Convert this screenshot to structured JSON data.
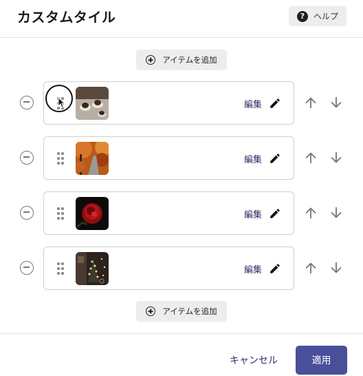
{
  "header": {
    "title": "カスタムタイル",
    "help_label": "ヘルプ"
  },
  "add_item_label": "アイテムを追加",
  "items": [
    {
      "edit_label": "編集",
      "thumbnail": "chocolate-dessert-photo"
    },
    {
      "edit_label": "編集",
      "thumbnail": "autumn-path-photo"
    },
    {
      "edit_label": "編集",
      "thumbnail": "red-rose-photo"
    },
    {
      "edit_label": "編集",
      "thumbnail": "night-street-lights-photo"
    }
  ],
  "footer": {
    "cancel_label": "キャンセル",
    "apply_label": "適用"
  },
  "colors": {
    "accent": "#4a4f9a",
    "link": "#2c2f66",
    "border": "#cfcfcf"
  }
}
